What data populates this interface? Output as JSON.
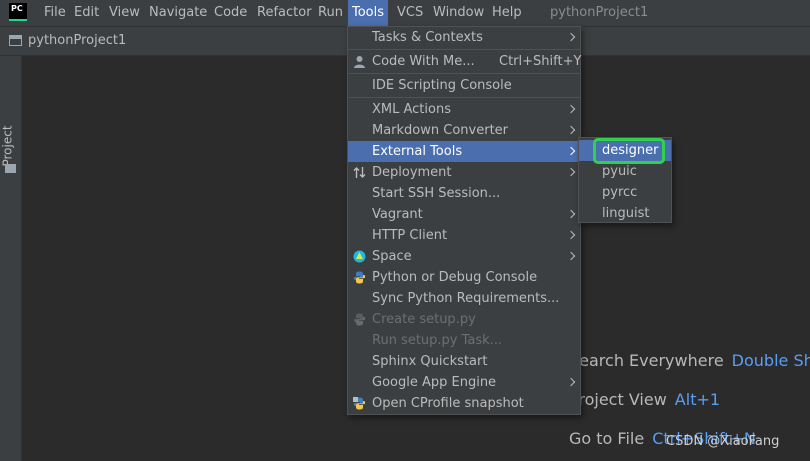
{
  "menubar": {
    "logo_text": "PC",
    "items": [
      "File",
      "Edit",
      "View",
      "Navigate",
      "Code",
      "Refactor",
      "Run",
      "Tools",
      "VCS",
      "Window",
      "Help"
    ],
    "active_item": "Tools",
    "window_title": "pythonProject1"
  },
  "navbar": {
    "project_name": "pythonProject1"
  },
  "left_strip": {
    "project_tab": "Project"
  },
  "tools_menu": {
    "items": [
      {
        "label": "Tasks & Contexts",
        "submenu": true
      },
      {
        "label": "Code With Me...",
        "shortcut": "Ctrl+Shift+Y",
        "icon": "user-icon"
      },
      {
        "label": "IDE Scripting Console"
      },
      {
        "label": "XML Actions",
        "submenu": true
      },
      {
        "label": "Markdown Converter",
        "submenu": true
      },
      {
        "label": "External Tools",
        "submenu": true,
        "selected": true
      },
      {
        "label": "Deployment",
        "submenu": true,
        "icon": "deployment-icon"
      },
      {
        "label": "Start SSH Session..."
      },
      {
        "label": "Vagrant",
        "submenu": true
      },
      {
        "label": "HTTP Client",
        "submenu": true
      },
      {
        "label": "Space",
        "submenu": true,
        "icon": "space-icon"
      },
      {
        "label": "Python or Debug Console",
        "icon": "python-icon"
      },
      {
        "label": "Sync Python Requirements..."
      },
      {
        "label": "Create setup.py",
        "disabled": true,
        "icon": "python-icon"
      },
      {
        "label": "Run setup.py Task...",
        "disabled": true
      },
      {
        "label": "Sphinx Quickstart"
      },
      {
        "label": "Google App Engine",
        "submenu": true
      },
      {
        "label": "Open CProfile snapshot",
        "icon": "cprofile-icon"
      }
    ]
  },
  "external_tools_submenu": {
    "items": [
      "designer",
      "pyuic",
      "pyrcc",
      "linguist"
    ],
    "selected": "designer"
  },
  "editor_hints": [
    {
      "label": "Search Everywhere",
      "shortcut": "Double Shift"
    },
    {
      "label": "Project View",
      "shortcut": "Alt+1"
    },
    {
      "label": "Go to File",
      "shortcut": "Ctrl+Shift+N"
    }
  ],
  "watermark": "CSDN @XiaoFang",
  "colors": {
    "background": "#2b2b2b",
    "chrome": "#3c3f41",
    "selection": "#4b6eaf",
    "shortcut_blue": "#589df6",
    "highlight_green": "#2fd14f"
  }
}
